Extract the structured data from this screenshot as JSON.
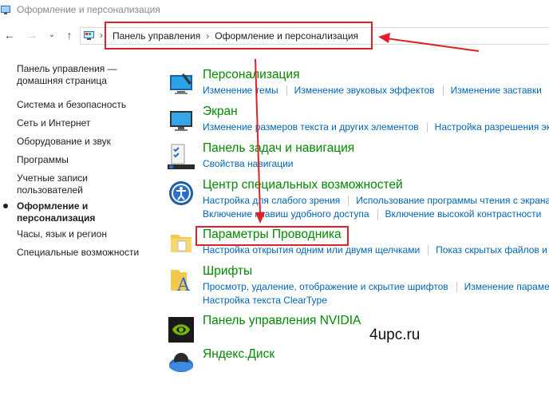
{
  "window": {
    "title": "Оформление и персонализация"
  },
  "breadcrumb": {
    "items": [
      "Панель управления",
      "Оформление и персонализация"
    ],
    "separator": "›"
  },
  "sidebar": {
    "home_line1": "Панель управления —",
    "home_line2": "домашняя страница",
    "items": [
      "Система и безопасность",
      "Сеть и Интернет",
      "Оборудование и звук",
      "Программы"
    ],
    "accounts_line1": "Учетные записи",
    "accounts_line2": "пользователей",
    "active_line1": "Оформление и",
    "active_line2": "персонализация",
    "clock": "Часы, язык и регион",
    "ease": "Специальные возможности"
  },
  "categories": [
    {
      "title": "Персонализация",
      "icon": "personalization-icon",
      "rows": [
        [
          "Изменение темы",
          "Изменение звуковых эффектов",
          "Изменение заставки"
        ]
      ]
    },
    {
      "title": "Экран",
      "icon": "display-icon",
      "rows": [
        [
          "Изменение размеров текста и других элементов",
          "Настройка разрешения эк"
        ]
      ]
    },
    {
      "title": "Панель задач и навигация",
      "icon": "taskbar-icon",
      "rows": [
        [
          "Свойства навигации"
        ]
      ]
    },
    {
      "title": "Центр специальных возможностей",
      "icon": "ease-of-access-icon",
      "rows": [
        [
          "Настройка для слабого зрения",
          "Использование программы чтения с экрана"
        ],
        [
          "Включение клавиш удобного доступа",
          "Включение высокой контрастности"
        ]
      ]
    },
    {
      "title": "Параметры Проводника",
      "icon": "folder-options-icon",
      "rows": [
        [
          "Настройка открытия одним или двумя щелчками",
          "Показ скрытых файлов и"
        ]
      ]
    },
    {
      "title": "Шрифты",
      "icon": "fonts-icon",
      "rows": [
        [
          "Просмотр, удаление, отображение и скрытие шрифтов",
          "Изменение параме"
        ],
        [
          "Настройка текста ClearType"
        ]
      ]
    },
    {
      "title": "Панель управления NVIDIA",
      "icon": "nvidia-icon",
      "rows": []
    },
    {
      "title": "Яндекс.Диск",
      "icon": "yandex-disk-icon",
      "rows": []
    }
  ],
  "watermark": "4upc.ru",
  "colors": {
    "category_title": "#008a00",
    "link": "#0066b4",
    "annotation": "#e0212a"
  }
}
